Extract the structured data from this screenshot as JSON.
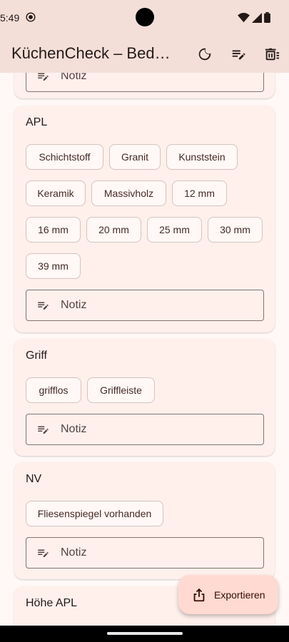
{
  "status_bar": {
    "time": "5:49",
    "icons": [
      "app-notification-icon",
      "wifi-icon",
      "cellular-icon",
      "battery-icon"
    ]
  },
  "app_bar": {
    "title": "KüchenCheck – Bedarfsanalyse",
    "actions": [
      "dark-mode-icon",
      "edit-list-icon",
      "delete-list-icon"
    ]
  },
  "sections": {
    "partial": {
      "note_label": "Notiz"
    },
    "apl": {
      "title": "APL",
      "chips": [
        "Schichtstoff",
        "Granit",
        "Kunststein",
        "Keramik",
        "Massivholz",
        "12 mm",
        "16 mm",
        "20 mm",
        "25 mm",
        "30 mm",
        "39 mm"
      ],
      "note_label": "Notiz"
    },
    "griff": {
      "title": "Griff",
      "chips": [
        "grifflos",
        "Griffleiste"
      ],
      "note_label": "Notiz"
    },
    "nv": {
      "title": "NV",
      "chips": [
        "Fliesenspiegel vorhanden"
      ],
      "note_label": "Notiz"
    },
    "hoehe_apl": {
      "title": "Höhe APL"
    }
  },
  "fab": {
    "label": "Exportieren",
    "icon": "share-icon"
  },
  "colors": {
    "surface": "#fff8f6",
    "card": "#fff0ec",
    "app_bar": "#f3dfd8",
    "chip_border": "#d8c2bc",
    "outline": "#85736e",
    "fab": "#ffdad2"
  }
}
